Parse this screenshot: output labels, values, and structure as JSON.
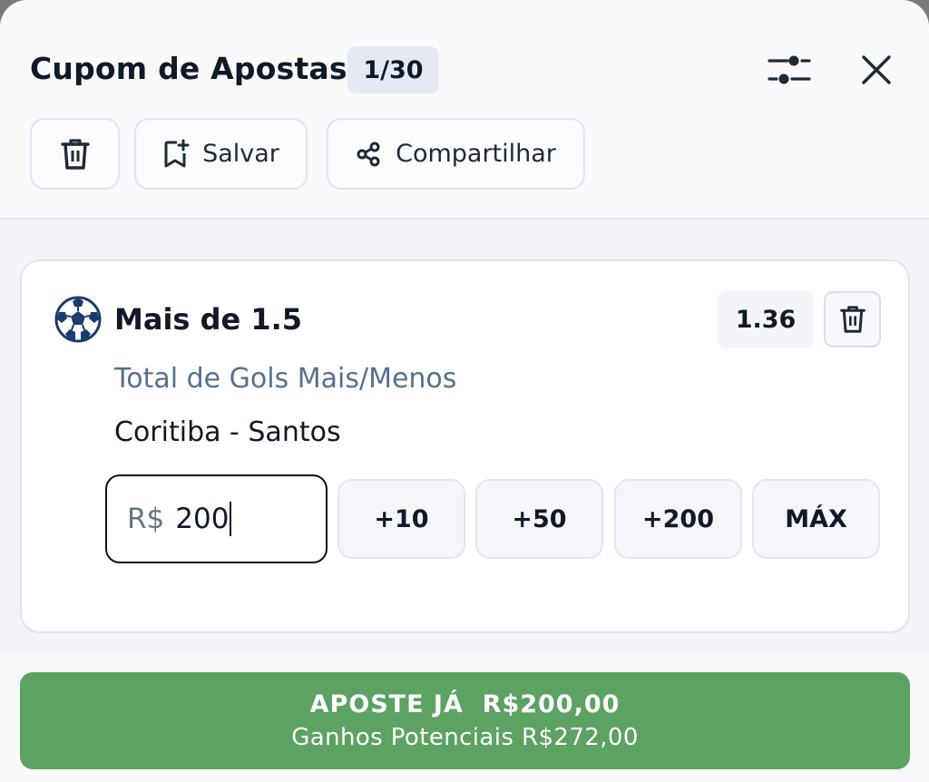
{
  "header": {
    "title": "Cupom de Apostas",
    "count": "1/30",
    "filter_icon": "sliders-icon",
    "close_icon": "close-icon"
  },
  "toolbar": {
    "save_label": "Salvar",
    "share_label": "Compartilhar"
  },
  "bet": {
    "sport_icon": "soccer-ball-icon",
    "selection": "Mais de 1.5",
    "odds": "1.36",
    "market": "Total de Gols Mais/Menos",
    "match": "Coritiba - Santos",
    "stake": {
      "currency": "R$",
      "value": "200"
    },
    "quick_amounts": [
      "+10",
      "+50",
      "+200",
      "MÁX"
    ]
  },
  "footer": {
    "place_bet_label": "APOSTE JÁ  R$200,00",
    "potential_label": "Ganhos Potenciais R$272,00"
  },
  "colors": {
    "accent_green": "#5ca262",
    "market_text": "#56708f",
    "badge_bg": "#e5e9f4"
  }
}
